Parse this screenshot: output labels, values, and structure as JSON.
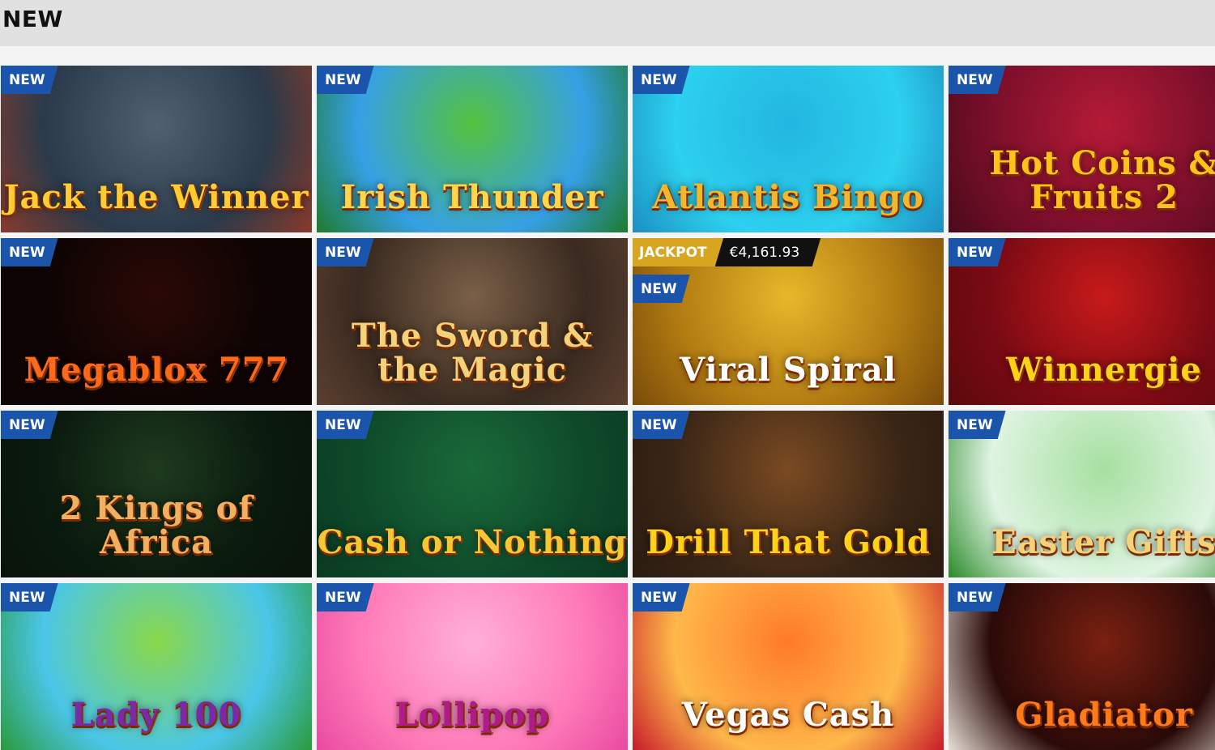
{
  "header": {
    "title": "NEW"
  },
  "badge_label": "NEW",
  "jackpot": {
    "label": "JACKPOT",
    "amount": "€4,161.93"
  },
  "games": [
    {
      "title": "Jack the Winner",
      "colors": [
        "#2b3a4a",
        "#506070",
        "#8a3a2a"
      ],
      "text_color": "#ffcc33"
    },
    {
      "title": "Irish Thunder",
      "colors": [
        "#36a0e6",
        "#54c23d",
        "#1e7a2a"
      ],
      "text_color": "#ffd54a"
    },
    {
      "title": "Atlantis Bingo",
      "colors": [
        "#2dd0ee",
        "#22b6e0",
        "#1c8ec2"
      ],
      "text_color": "#f2b72c"
    },
    {
      "title": "Hot Coins & Fruits 2",
      "colors": [
        "#7a0f2a",
        "#b51a36",
        "#4a0a1a"
      ],
      "text_color": "#ffc21a"
    },
    {
      "title": "Megablox 777",
      "colors": [
        "#0d0403",
        "#2a0906",
        "#0d0403"
      ],
      "text_color": "#ff6a1a"
    },
    {
      "title": "The Sword & the Magic",
      "colors": [
        "#3a2a20",
        "#7a6048",
        "#5a4030"
      ],
      "text_color": "#f4d27a"
    },
    {
      "title": "Viral Spiral",
      "colors": [
        "#b07a12",
        "#e8b82a",
        "#7a4a0a"
      ],
      "text_color": "#ffffff"
    },
    {
      "title": "Winnergie",
      "colors": [
        "#7a0a14",
        "#c81a1a",
        "#5a0a0a"
      ],
      "text_color": "#ffd21a"
    },
    {
      "title": "2 Kings of Africa",
      "colors": [
        "#0a1a0e",
        "#1e3a1e",
        "#0a140a"
      ],
      "text_color": "#f0b060"
    },
    {
      "title": "Cash or Nothing",
      "colors": [
        "#0e4a2a",
        "#1a6a3a",
        "#0a3a22"
      ],
      "text_color": "#f5c832"
    },
    {
      "title": "Drill That Gold",
      "colors": [
        "#3a2616",
        "#7a4a22",
        "#2a1a10"
      ],
      "text_color": "#ffd21a"
    },
    {
      "title": "Easter Gifts",
      "colors": [
        "#dff4e2",
        "#a6e0a0",
        "#2a8a2a"
      ],
      "text_color": "#f4d27a"
    },
    {
      "title": "Lady 100",
      "colors": [
        "#4ac6e8",
        "#8ad84a",
        "#2a9a3a"
      ],
      "text_color": "#7a2aa8"
    },
    {
      "title": "Lollipop",
      "colors": [
        "#ff7ab8",
        "#ffb0d8",
        "#e84aa0"
      ],
      "text_color": "#b01a8a"
    },
    {
      "title": "Vegas Cash",
      "colors": [
        "#ffb84a",
        "#ff7a2a",
        "#c81a2a"
      ],
      "text_color": "#ffffff"
    },
    {
      "title": "Gladiator",
      "colors": [
        "#2a0a08",
        "#7a2010",
        "#e8e0d8"
      ],
      "text_color": "#ff7a1a"
    }
  ]
}
